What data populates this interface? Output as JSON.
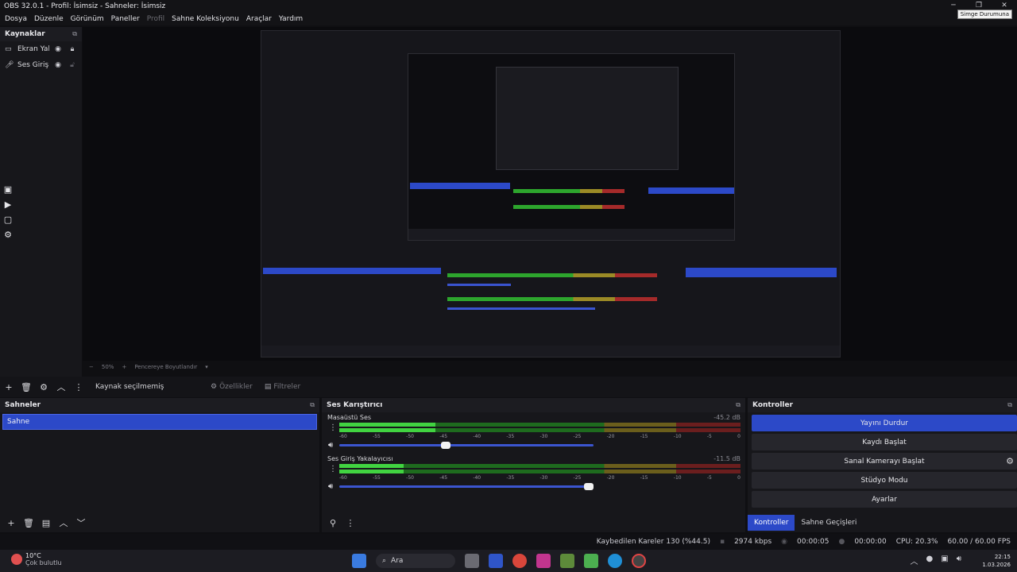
{
  "window": {
    "title": "OBS 32.0.1 - Profil: İsimsiz - Sahneler: İsimsiz",
    "tooltip": "Simge Durumuna"
  },
  "menu": [
    "Dosya",
    "Düzenle",
    "Görünüm",
    "Paneller",
    "Profil",
    "Sahne Koleksiyonu",
    "Araçlar",
    "Yardım"
  ],
  "sources": {
    "title": "Kaynaklar",
    "items": [
      {
        "label": "Ekran Yak",
        "icon": "monitor-icon"
      },
      {
        "label": "Ses Giriş Y",
        "icon": "microphone-icon"
      }
    ]
  },
  "preview_strip": {
    "fps": "50%",
    "mode": "Pencereye Boyutlandır"
  },
  "source_toolbar": {
    "no_selection": "Kaynak seçilmemiş",
    "properties": "Özellikler",
    "filters": "Filtreler"
  },
  "scenes": {
    "title": "Sahneler",
    "items": [
      "Sahne"
    ]
  },
  "mixer": {
    "title": "Ses Karıştırıcı",
    "ticks": [
      "-60",
      "-55",
      "-50",
      "-45",
      "-40",
      "-35",
      "-30",
      "-25",
      "-20",
      "-15",
      "-10",
      "-5",
      "0"
    ],
    "channels": [
      {
        "name": "Masaüstü Ses",
        "db": "-45.2 dB",
        "level_fraction": 0.24,
        "volume_fraction": 0.42
      },
      {
        "name": "Ses Giriş Yakalayıcısı",
        "db": "-11.5 dB",
        "level_fraction": 0.16,
        "volume_fraction": 0.98
      }
    ]
  },
  "controls": {
    "title": "Kontroller",
    "buttons": [
      "Yayını Durdur",
      "Kaydı Başlat",
      "Sanal Kamerayı Başlat",
      "Stüdyo Modu",
      "Ayarlar"
    ],
    "tabs": [
      "Kontroller",
      "Sahne Geçişleri"
    ]
  },
  "status": {
    "dropped": "Kaybedilen Kareler 130 (%44.5)",
    "bitrate": "2974 kbps",
    "stream_time": "00:00:05",
    "rec_time": "00:00:00",
    "cpu": "CPU: 20.3%",
    "fps": "60.00 / 60.00 FPS"
  },
  "taskbar": {
    "temp": "10°C",
    "weather": "Çok bulutlu",
    "search": "Ara",
    "time": "22:15",
    "date": "1.03.2026"
  },
  "colors": {
    "accent": "#2c49c8",
    "meter_green": "#41d341",
    "bg": "#0f0f12"
  }
}
